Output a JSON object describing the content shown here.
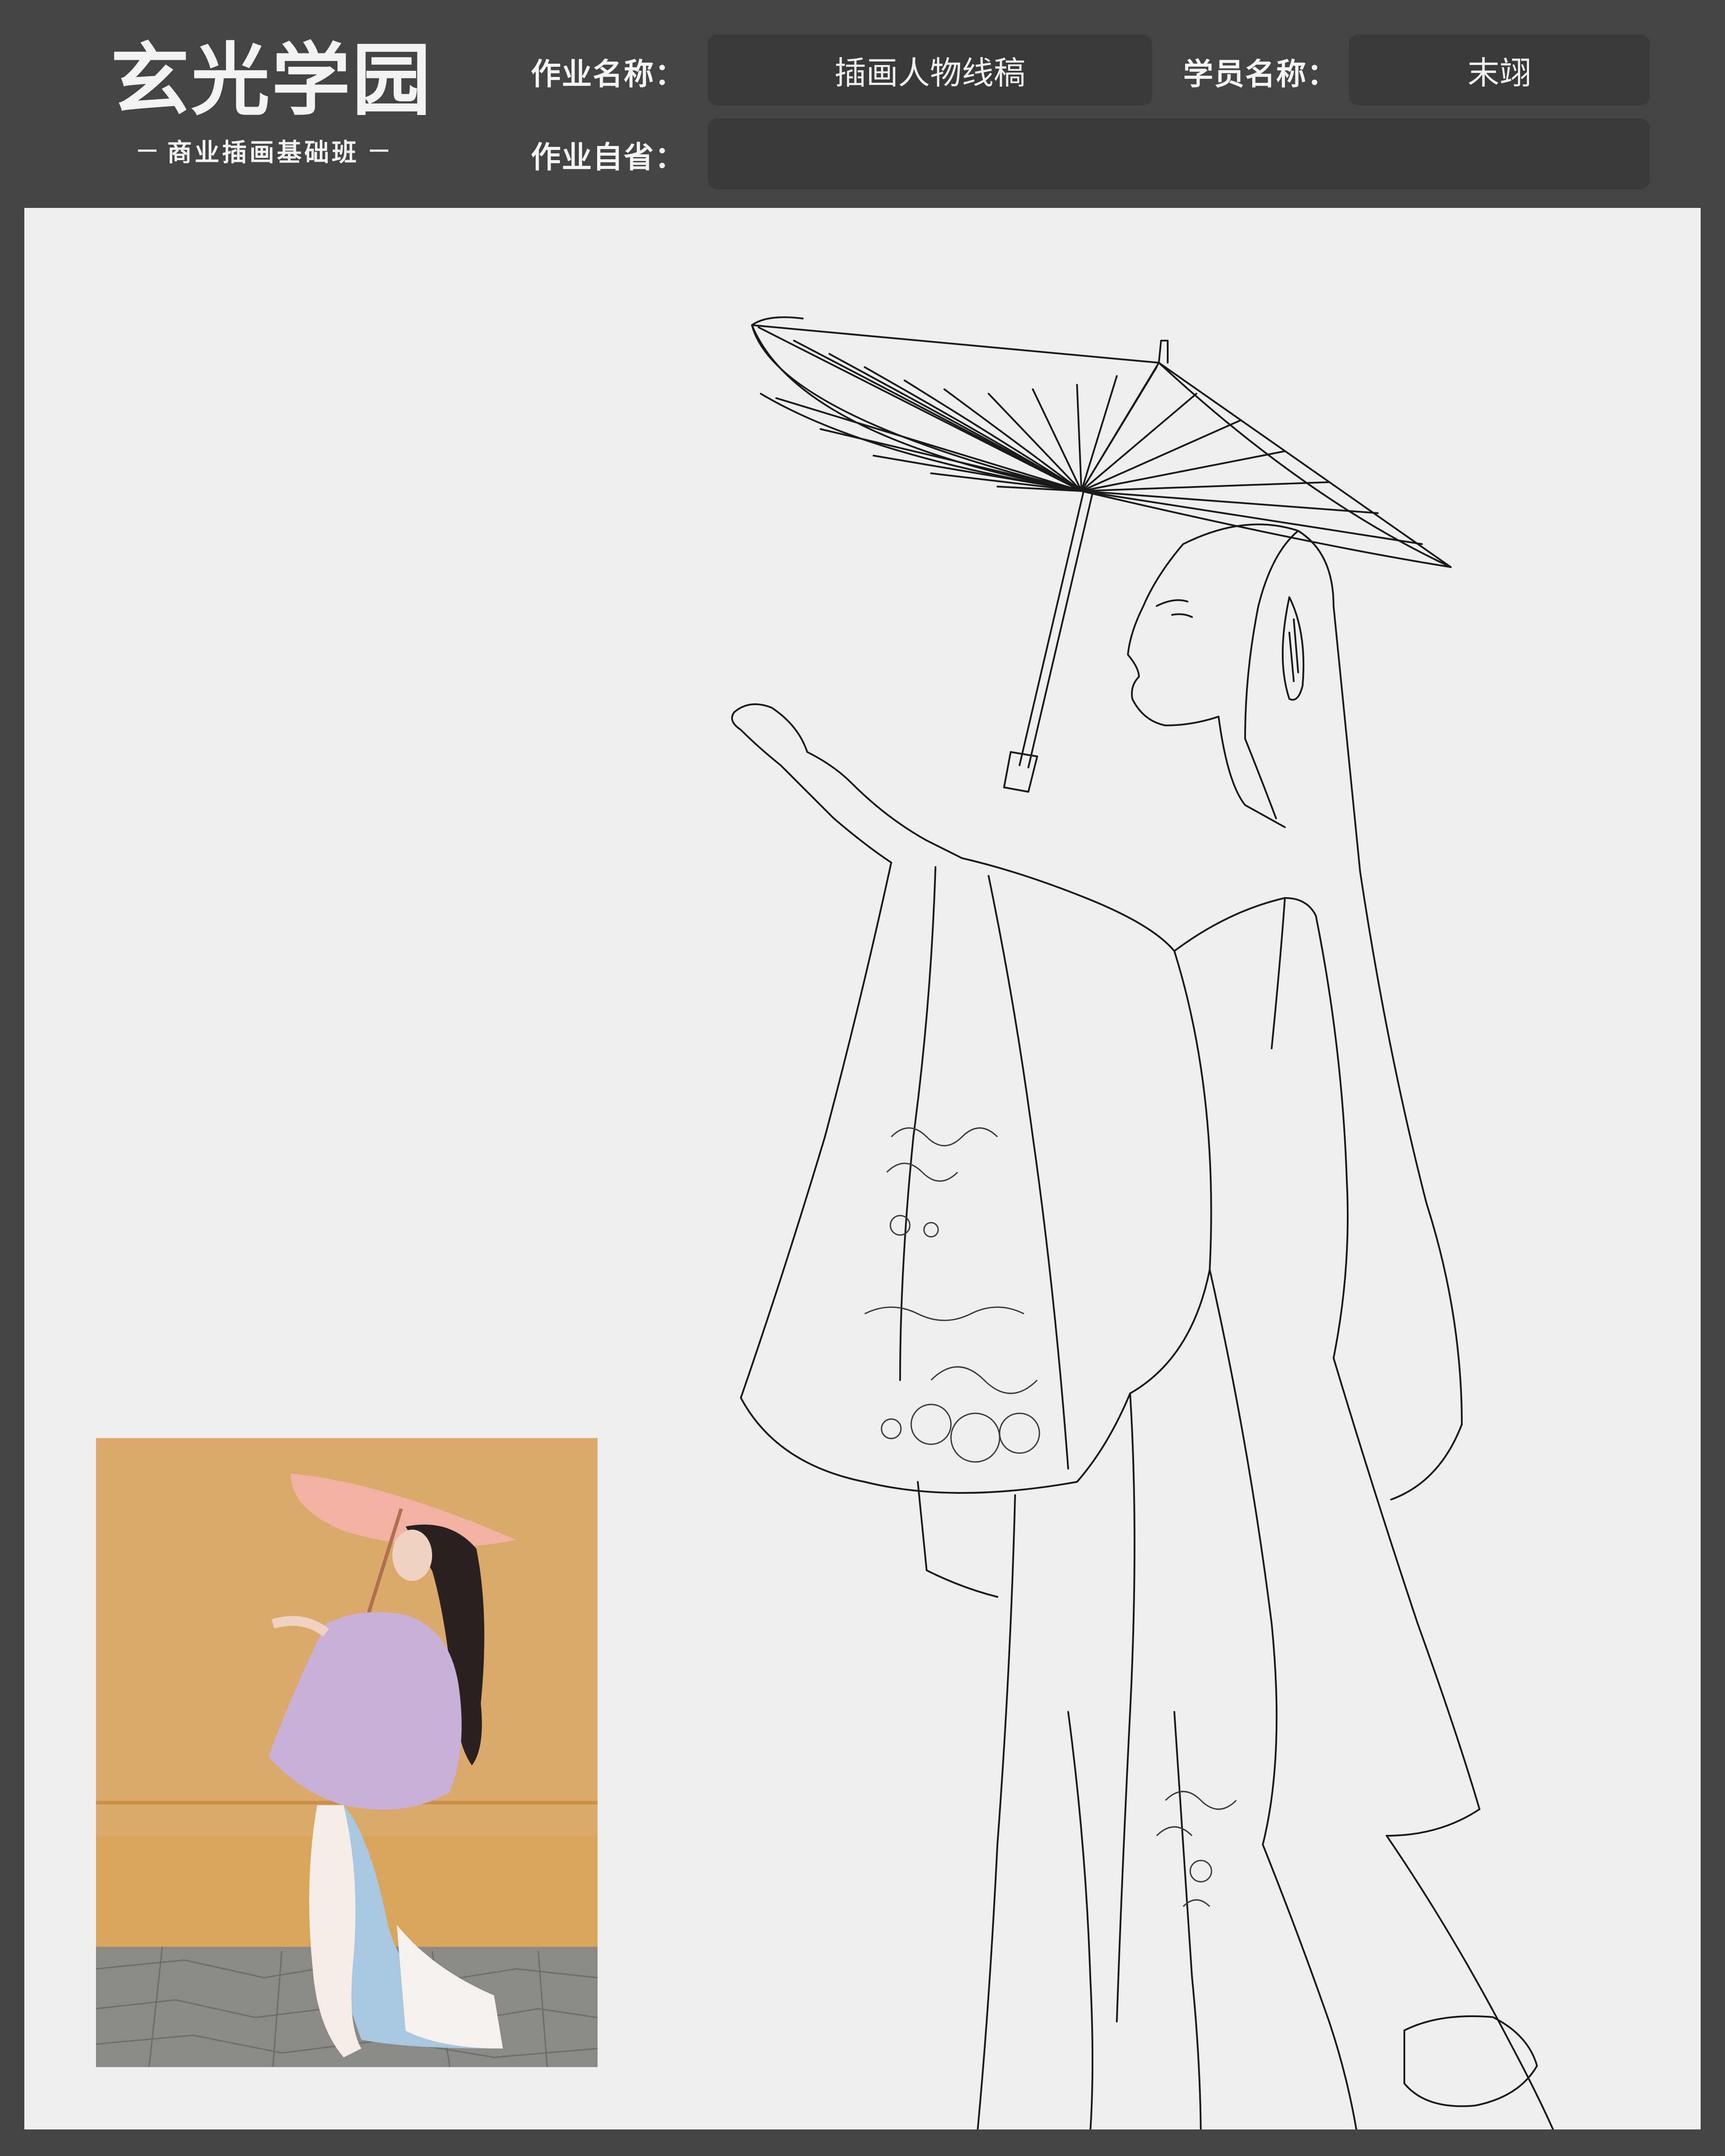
{
  "header": {
    "logo_title": "玄光学园",
    "logo_subtitle": "商业插画基础班",
    "assignment_name_label": "作业名称：",
    "assignment_name_value": "插画人物线稿",
    "student_name_label": "学员名称：",
    "student_name_value": "末翊",
    "self_review_label": "作业自省：",
    "self_review_value": ""
  },
  "colors": {
    "frame": "#454444",
    "field_box": "#3a3a3a",
    "canvas": "#efefef",
    "photo_wall": "#d9a55a",
    "photo_robe_purple": "#c9b0d8",
    "photo_skirt_blue": "#a9c7e0",
    "photo_umbrella": "#f2b2a3"
  }
}
